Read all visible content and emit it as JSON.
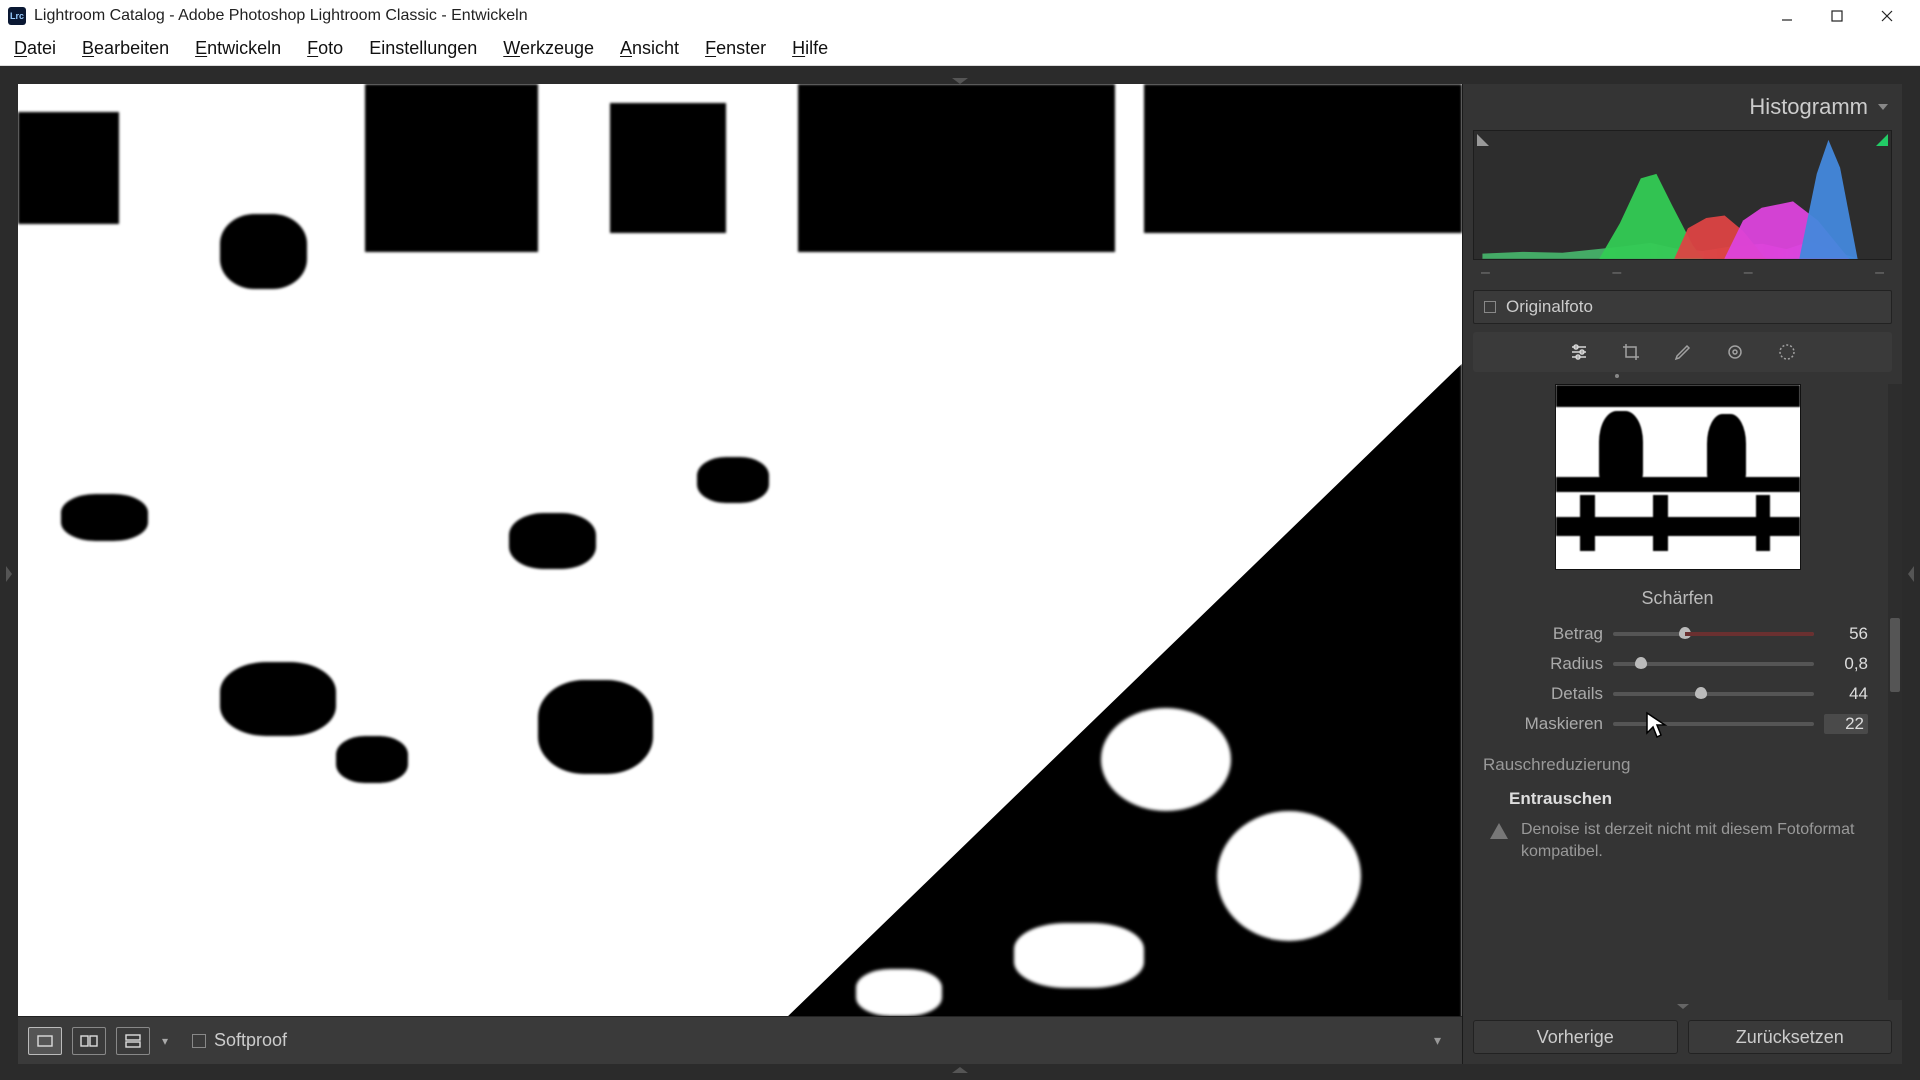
{
  "window": {
    "title": "Lightroom Catalog - Adobe Photoshop Lightroom Classic - Entwickeln"
  },
  "menu": {
    "file": "Datei",
    "file_mn": "D",
    "edit": "Bearbeiten",
    "edit_mn": "B",
    "develop": "Entwickeln",
    "develop_mn": "E",
    "photo": "Foto",
    "photo_mn": "F",
    "settings": "Einstellungen",
    "settings_mn": "E",
    "tools": "Werkzeuge",
    "tools_mn": "W",
    "view": "Ansicht",
    "view_mn": "A",
    "window": "Fenster",
    "window_mn": "F",
    "help": "Hilfe",
    "help_mn": "H"
  },
  "toolbar": {
    "softproof_label": "Softproof"
  },
  "panel": {
    "histogram_title": "Histogramm",
    "hist_dashes": [
      "–",
      "–",
      "–",
      "–"
    ],
    "original_label": "Originalfoto",
    "sharpen": {
      "title": "Schärfen",
      "amount_label": "Betrag",
      "amount_val": "56",
      "amount_pct": 36,
      "radius_label": "Radius",
      "radius_val": "0,8",
      "radius_pct": 14,
      "details_label": "Details",
      "details_val": "44",
      "details_pct": 44,
      "mask_label": "Maskieren",
      "mask_val": "22",
      "mask_pct": 22
    },
    "noise": {
      "title": "Rauschreduzierung",
      "denoise_title": "Entrauschen",
      "denoise_msg": "Denoise ist derzeit nicht mit diesem Fotoformat kompatibel."
    },
    "buttons": {
      "prev": "Vorherige",
      "reset": "Zurücksetzen"
    }
  }
}
